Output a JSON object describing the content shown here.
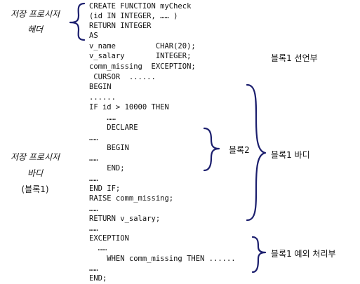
{
  "code_lines": [
    "CREATE FUNCTION myCheck",
    "(id IN INTEGER, …… )",
    "RETURN INTEGER",
    "AS",
    "v_name         CHAR(20);",
    "v_salary       INTEGER;",
    "comm_missing  EXCEPTION;",
    " CURSOR  ......",
    "BEGIN",
    "......",
    "IF id > 10000 THEN",
    "    ……",
    "    DECLARE",
    "……",
    "    BEGIN",
    "……",
    "    END;",
    "……",
    "END IF;",
    "RAISE comm_missing;",
    "……",
    "RETURN v_salary;",
    "……",
    "EXCEPTION",
    "  ……",
    "    WHEN comm_missing THEN ......",
    "……",
    "END;"
  ],
  "left_labels": {
    "header_line1": "저장 프로시저",
    "header_line2": "헤더",
    "body_line1": "저장 프로시저",
    "body_line2": "바디",
    "body_line3": "(블록1)"
  },
  "right_labels": {
    "declaration": "블록1 선언부",
    "block2": "블록2",
    "body": "블록1 바디",
    "exception": "블록1 예외 처리부"
  }
}
